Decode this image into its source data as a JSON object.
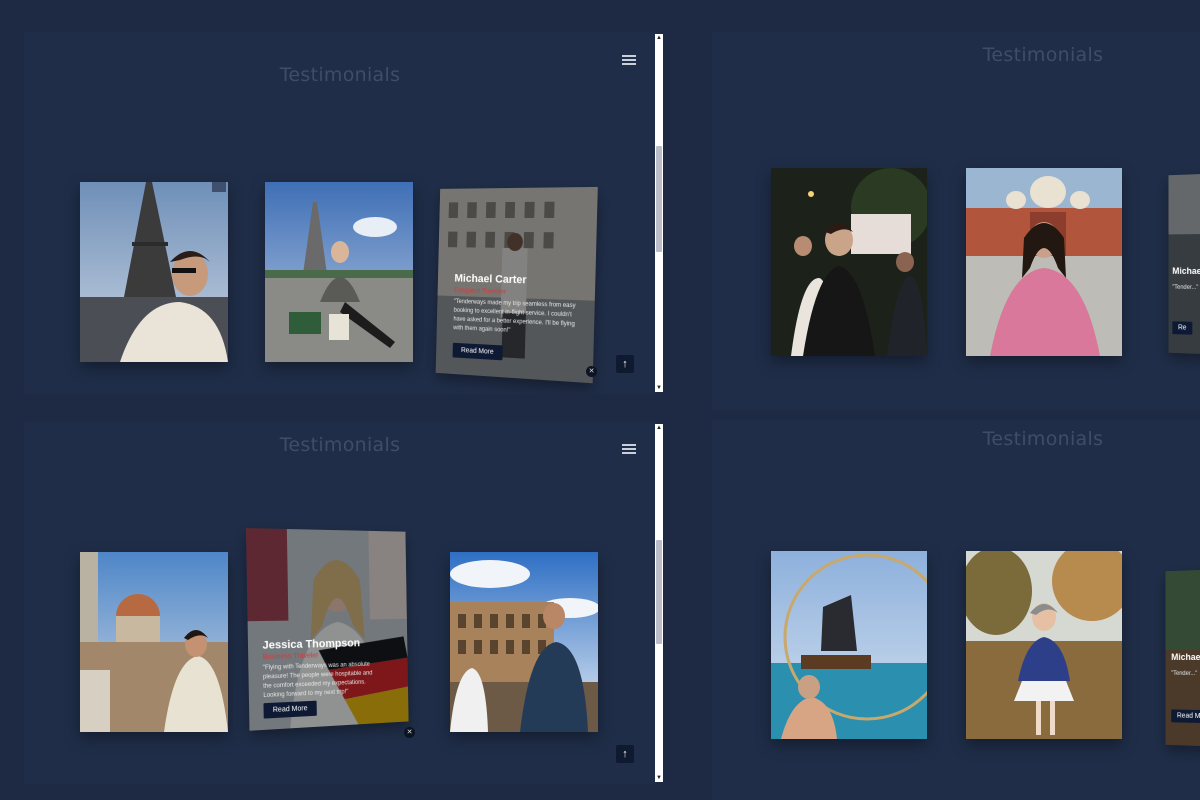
{
  "panels": [
    {
      "title": "Testimonials",
      "cards": [
        {
          "alt": "Man in front of Eiffel Tower"
        },
        {
          "alt": "Woman sitting near Eiffel Tower with Avenue de New York sign"
        },
        {
          "alt": "Michael Carter testimonial",
          "name": "Michael Carter",
          "role": "Frequent Traveler",
          "text": "\"Tenderways made my trip seamless from easy booking to excellent in-flight service. I couldn't have asked for a better experience. I'll be flying with them again soon!\"",
          "button": "Read More"
        }
      ]
    },
    {
      "title": "Testimonials",
      "cards": [
        {
          "alt": "Group photo at night"
        },
        {
          "alt": "Woman in front of Taj Mahal"
        },
        {
          "alt": "Michael testimonial partial",
          "name": "Michae",
          "text": "\"Tender...\"",
          "button": "Re"
        }
      ]
    },
    {
      "title": "Testimonials",
      "cards": [
        {
          "alt": "Man in Florence with Duomo"
        },
        {
          "alt": "Jessica Thompson testimonial",
          "name": "Jessica Thompson",
          "role": "Business Traveler",
          "text": "\"Flying with Tenderways was an absolute pleasure! The people were hospitable and the comfort exceeded my expectations. Looking forward to my next trip!\"",
          "button": "Read More"
        },
        {
          "alt": "Man photographing the Colosseum"
        }
      ]
    },
    {
      "title": "Testimonials",
      "cards": [
        {
          "alt": "Man in sea with pirate ship"
        },
        {
          "alt": "Woman in autumn park with coffee"
        },
        {
          "alt": "Michael testimonial partial",
          "name": "Michae",
          "text": "\"Tender...\"",
          "button": "Read M"
        }
      ]
    }
  ],
  "icons": {
    "menu": "hamburger-menu-icon",
    "top": "arrow-up-icon",
    "close": "close-icon"
  },
  "glyphs": {
    "up": "↑",
    "close": "✕",
    "scroll_up": "▲",
    "scroll_down": "▼"
  },
  "colors": {
    "background": "#1e2a44",
    "accent_red": "#d13b3b",
    "button": "#0e1a33"
  }
}
